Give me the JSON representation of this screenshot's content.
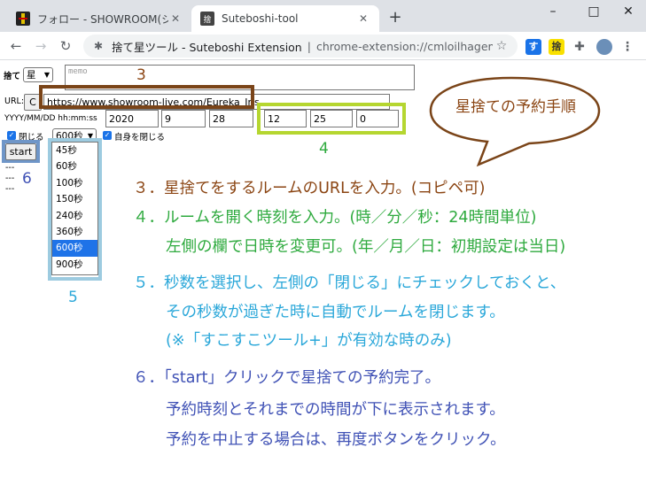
{
  "browser": {
    "tabs": [
      {
        "title": "フォロー - SHOWROOM(ショールーム)",
        "active": false
      },
      {
        "title": "Suteboshi-tool",
        "active": true
      }
    ],
    "window_controls": {
      "minimize": "–",
      "maximize": "□",
      "close": "✕"
    },
    "omnibox": {
      "title": "捨て星ツール - Suteboshi Extension",
      "separator": "|",
      "path": "chrome-extension://cmloilhagemnefekf..."
    },
    "extensions": [
      "す",
      "捨"
    ]
  },
  "form": {
    "suteru_label": "捨て",
    "star_select": "星",
    "memo_placeholder": "memo",
    "url_label": "URL:",
    "url_prefix_button": "C",
    "url_value": "https://www.showroom-live.com/Eureka_Iris",
    "datetime_label": "YYYY/MM/DD hh:mm:ss",
    "year": "2020",
    "month": "9",
    "day": "28",
    "hour": "12",
    "minute": "25",
    "second": "0",
    "close_label": "閉じる",
    "seconds_select": "600秒",
    "close_self_label": "自身を閉じる",
    "start_button": "start",
    "status_lines": [
      "---",
      "---",
      "---"
    ],
    "seconds_options": [
      "45秒",
      "60秒",
      "100秒",
      "150秒",
      "240秒",
      "360秒",
      "600秒",
      "900秒"
    ],
    "selected_option": "600秒"
  },
  "callouts": {
    "n3": "3",
    "n4": "4",
    "n5": "5",
    "n6": "6",
    "bubble": "星捨ての予約手順"
  },
  "instructions": {
    "step3": "３．星捨てをするルームのURLを入力。(コピペ可)",
    "step4a": "４．ルームを開く時刻を入力。(時／分／秒：24時間単位)",
    "step4b": "左側の欄で日時を変更可。(年／月／日：初期設定は当日)",
    "step5a": "５．秒数を選択し、左側の「閉じる」にチェックしておくと、",
    "step5b": "その秒数が過ぎた時に自動でルームを閉じます。",
    "step5c": "(※「すこすこツール+」が有効な時のみ)",
    "step6a": "６．「start」クリックで星捨ての予約完了。",
    "step6b": "予約時刻とそれまでの時間が下に表示されます。",
    "step6c": "予約を中止する場合は、再度ボタンをクリック。"
  },
  "colors": {
    "brown": "#8b4513",
    "green": "#2eaa3e",
    "light_blue": "#2aa7d9",
    "indigo": "#3f51b5",
    "box_brown": "#7a4418",
    "box_green": "#b5d630",
    "box_blue": "#9dcbe0"
  }
}
